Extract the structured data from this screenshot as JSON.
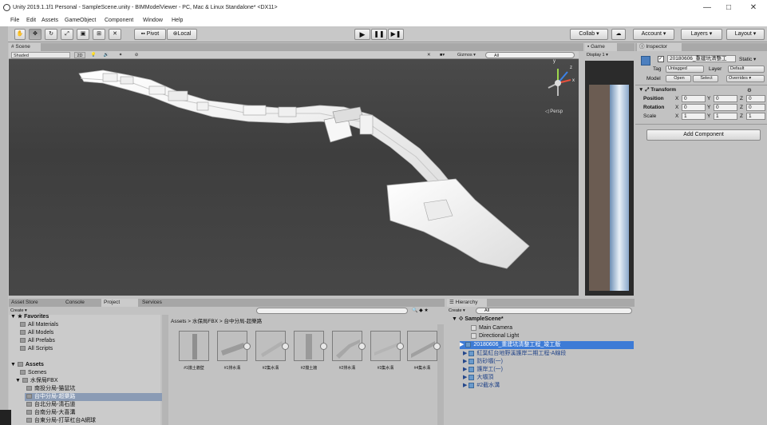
{
  "window": {
    "title": "Unity 2019.1.1f1 Personal - SampleScene.unity - BIMModelViewer - PC, Mac & Linux Standalone* <DX11>",
    "minimize": "—",
    "maximize": "□",
    "close": "✕"
  },
  "menu": [
    "File",
    "Edit",
    "Assets",
    "GameObject",
    "Component",
    "Window",
    "Help"
  ],
  "toolbar": {
    "pivot": "Pivot",
    "local": "Local",
    "collab": "Collab ▾",
    "account": "Account ▾",
    "layers": "Layers ▾",
    "layout": "Layout ▾"
  },
  "scene": {
    "tab": "# Scene",
    "shading": "Shaded",
    "mode2d": "2D",
    "gizmos": "Gizmos ▾",
    "search_placeholder": "All",
    "persp": "◁ Persp",
    "axis_y": "y",
    "axis_z": "z",
    "axis_x": "x"
  },
  "game": {
    "tab": "Game",
    "display": "Display 1 ▾"
  },
  "inspector": {
    "tab": "Inspector",
    "object_name": "20180606_重建坑清整工",
    "static_label": "Static ▾",
    "tag_label": "Tag",
    "tag_value": "Untagged",
    "layer_label": "Layer",
    "layer_value": "Default",
    "model_label": "Model",
    "open": "Open",
    "select": "Select",
    "overrides": "Overrides ▾",
    "transform": "Transform",
    "position": "Position",
    "rotation": "Rotation",
    "scale": "Scale",
    "pos": {
      "x": "0",
      "y": "0",
      "z": "0"
    },
    "rot": {
      "x": "0",
      "y": "0",
      "z": "0"
    },
    "scl": {
      "x": "1",
      "y": "1",
      "z": "1"
    },
    "add_component": "Add Component"
  },
  "project": {
    "tabs": [
      "Asset Store",
      "Console",
      "Project",
      "Services"
    ],
    "create": "Create ▾",
    "favorites": "Favorites",
    "favorite_items": [
      "All Materials",
      "All Models",
      "All Prefabs",
      "All Scripts"
    ],
    "assets": "Assets",
    "asset_tree": [
      "Scenes",
      "水保局FBX",
      "南投分局-猫鼠坑",
      "台中分局-超樂路",
      "台北分局-清石道",
      "台南分局-大喜溝",
      "台東分局-打草杠台A網球"
    ],
    "breadcrumb": "Assets > 水保局FBX > 台中分局-超樂路",
    "thumbs": [
      "#1擋土牆壁",
      "#1排水溝",
      "#2集水溝",
      "#2擋土牆",
      "#2排水溝",
      "#3集水溝",
      "#4集水溝"
    ]
  },
  "hierarchy": {
    "tab": "Hierarchy",
    "create": "Create ▾",
    "search_placeholder": "All",
    "scene_name": "SampleScene*",
    "items": [
      "Main Camera",
      "Directional Light",
      "20180606_重建坑清整工程_竣工版",
      "紅葉紅台地野溪護岸二期工程-A線段",
      "防砂壩(一)",
      "護岸工(一)",
      "大壩頂",
      "#2截水溝"
    ]
  }
}
